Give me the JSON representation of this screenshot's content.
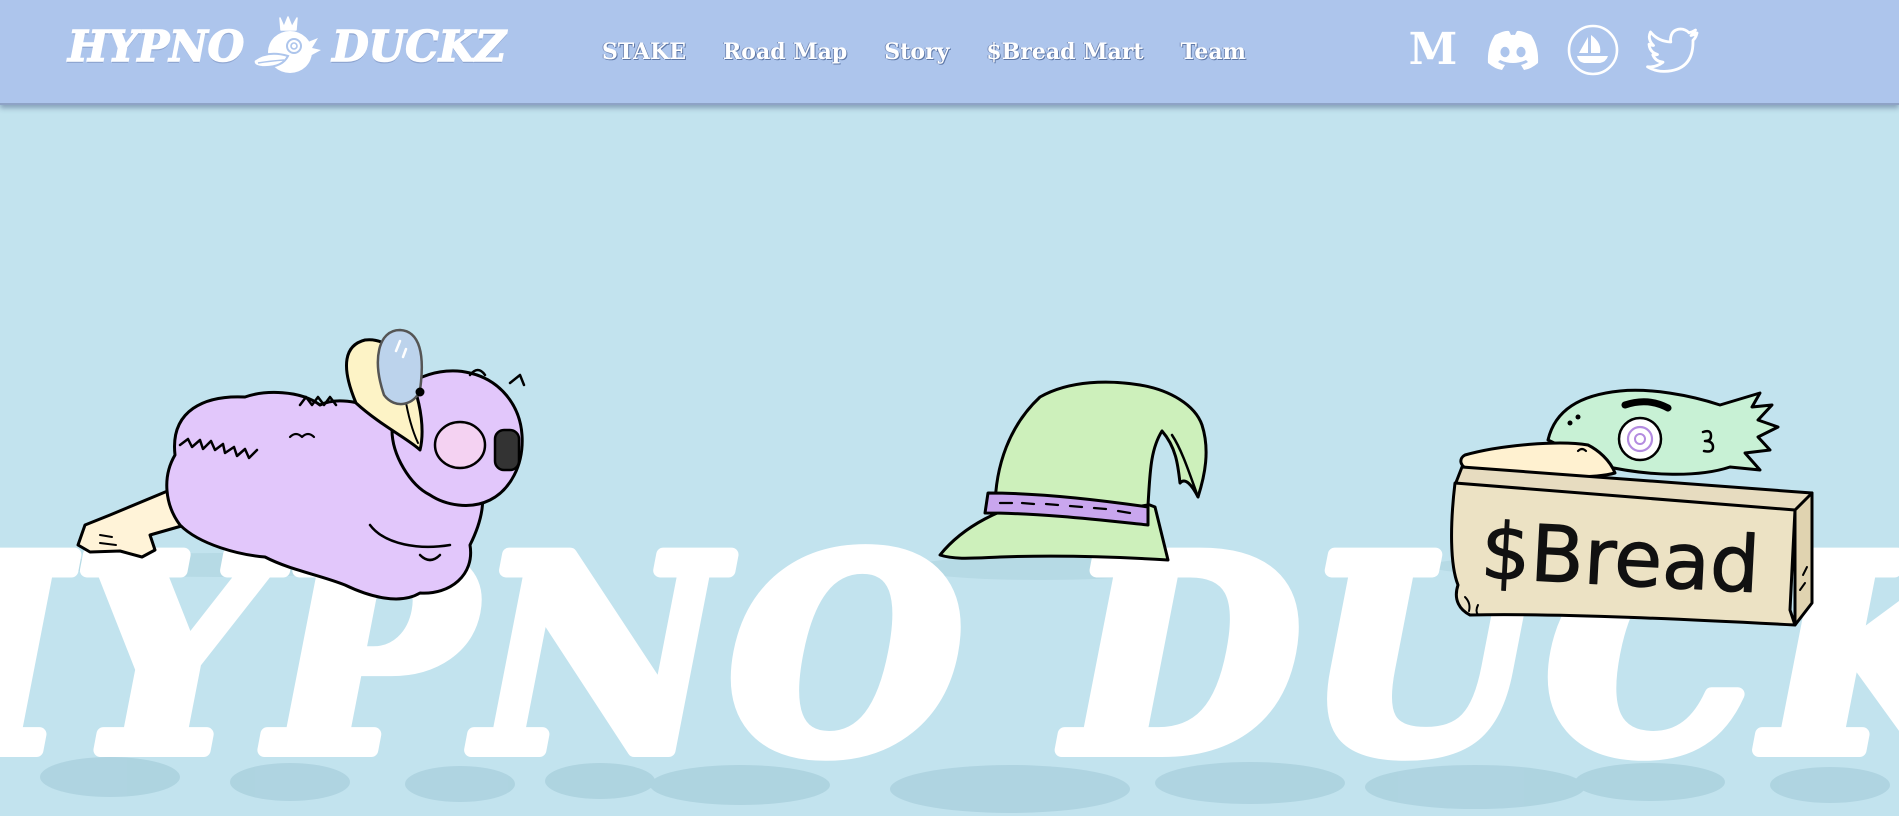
{
  "brand": {
    "logo_left": "HYPNO",
    "logo_right": "DUCKZ"
  },
  "nav": {
    "items": [
      "STAKE",
      "Road Map",
      "Story",
      "$Bread Mart",
      "Team"
    ]
  },
  "socials": {
    "medium_letter": "M",
    "icons": [
      "medium-icon",
      "discord-icon",
      "opensea-icon",
      "twitter-icon"
    ]
  },
  "hero": {
    "big_title": "HYPNO DUCKZ",
    "sign_text": "$Bread"
  },
  "colors": {
    "header_bg": "#adc5ec",
    "page_bg": "#c2e3ee",
    "title_color": "#ffffff",
    "duck_purple": "#e2c7fb",
    "hat_green": "#cdf0bb",
    "hat_band": "#c9a6ee",
    "duck_mint": "#c8f1d5",
    "sign_tan": "#ece2c4"
  }
}
